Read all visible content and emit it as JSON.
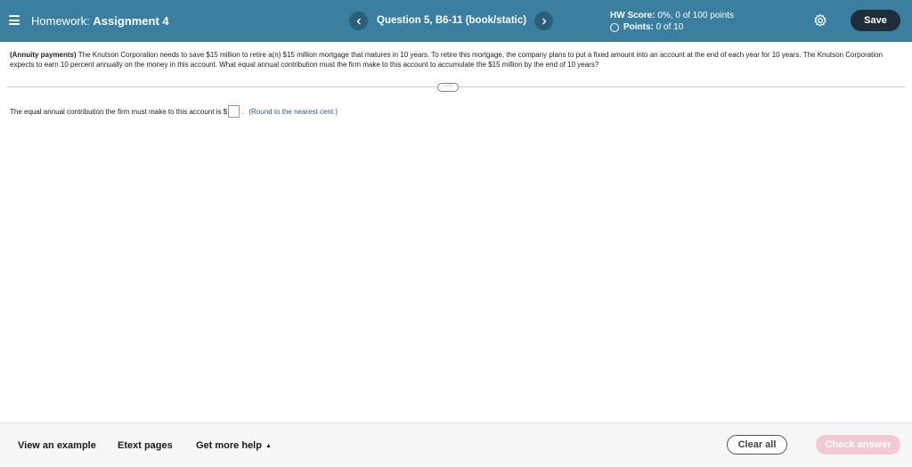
{
  "header": {
    "prefix": "Homework:",
    "assignment": "Assignment 4",
    "question_label": "Question 5, B6-11 (book/static)",
    "score_label": "HW Score:",
    "score_value": "0%, 0 of 100 points",
    "points_label": "Points:",
    "points_value": "0 of 10",
    "save_label": "Save"
  },
  "question": {
    "topic": "(Annuity payments)",
    "body": "The Knutson Corporation needs to save $15 million to retire a(n) $15 million mortgage that matures in 10 years.  To retire this mortgage, the company plans to put a fixed amount into an account at the end of each year for 10 years.  The Knutson Corporation expects to earn 10 percent annually on the money in this account.  What equal annual contribution must the firm make to this account to accumulate the $15 million by the end of 10 years?",
    "more_label": "·····"
  },
  "answer": {
    "prompt": "The equal annual contribution the firm must make to this account is $",
    "suffix": ".",
    "note": "(Round to the nearest cent.)",
    "value": ""
  },
  "footer": {
    "view_example": "View an example",
    "etext": "Etext pages",
    "more_help": "Get more help",
    "clear_all": "Clear all",
    "check_answer": "Check answer"
  },
  "colors": {
    "header_bg": "#3a7fa0",
    "nav_button": "#2a5f7a",
    "save_button": "#1f2d3a",
    "check_button": "#f3c9d2",
    "note_text": "#2b5a8a"
  }
}
